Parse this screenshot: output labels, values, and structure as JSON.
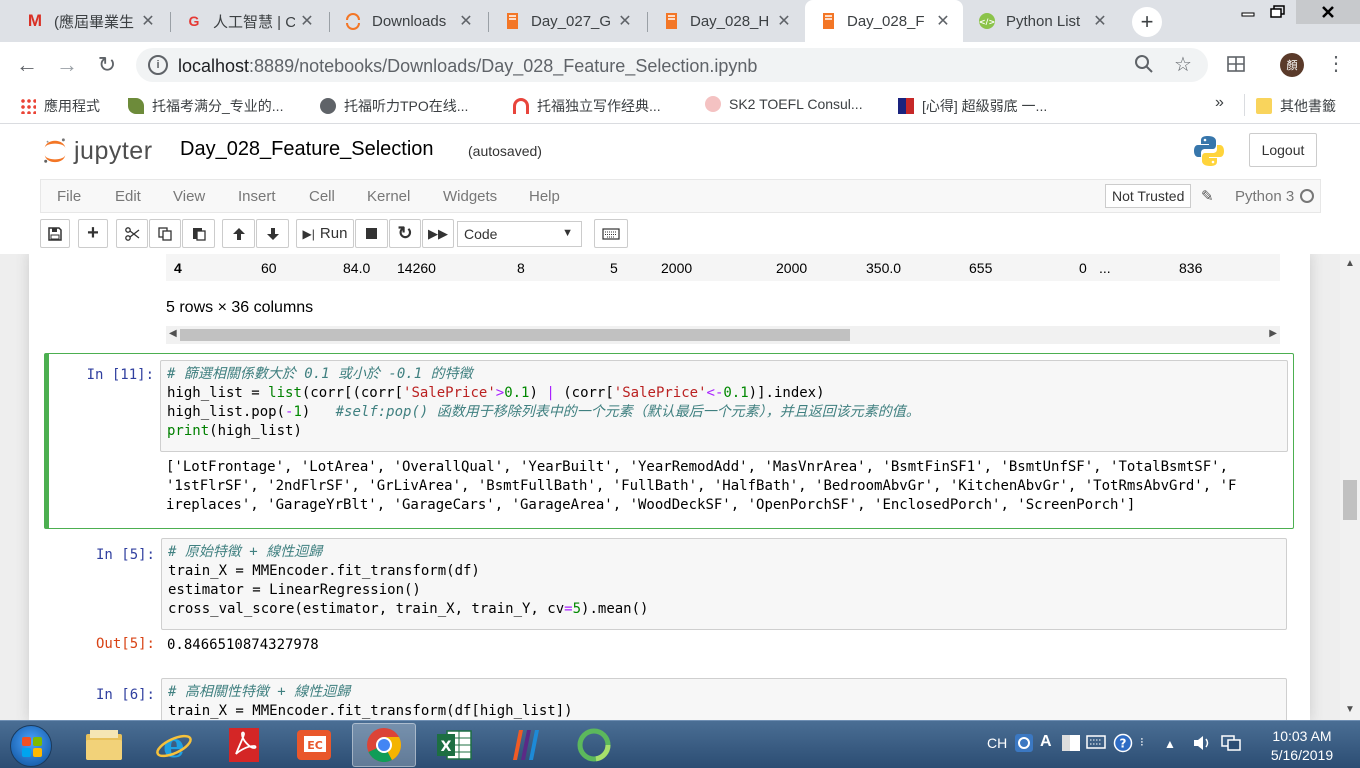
{
  "browser": {
    "tabs": [
      {
        "title": "(應屆畢業生",
        "icon": "gmail-icon",
        "active": false
      },
      {
        "title": "人工智慧 | C",
        "icon": "cupoy-icon",
        "active": false
      },
      {
        "title": "Downloads",
        "icon": "jupyter-tab-icon",
        "active": false
      },
      {
        "title": "Day_027_G",
        "icon": "notebook-tab-icon",
        "active": false
      },
      {
        "title": "Day_028_H",
        "icon": "notebook-tab-icon",
        "active": false
      },
      {
        "title": "Day_028_F",
        "icon": "notebook-tab-icon",
        "active": true
      },
      {
        "title": "Python List",
        "icon": "runoob-icon",
        "active": false
      }
    ],
    "url_host": "localhost",
    "url_rest": ":8889/notebooks/Downloads/Day_028_Feature_Selection.ipynb",
    "avatar_text": "顏",
    "bookmarks": [
      {
        "label": "應用程式"
      },
      {
        "label": "托福考满分_专业的..."
      },
      {
        "label": "托福听力TPO在线..."
      },
      {
        "label": "托福独立写作经典..."
      },
      {
        "label": "SK2 TOEFL Consul..."
      },
      {
        "label": "[心得] 超級弱底 一..."
      },
      {
        "label": "»"
      },
      {
        "label": "其他書籤"
      }
    ]
  },
  "jupyter": {
    "logo_text": "jupyter",
    "notebook_name": "Day_028_Feature_Selection",
    "autosave": "(autosaved)",
    "logout": "Logout",
    "menu": [
      "File",
      "Edit",
      "View",
      "Insert",
      "Cell",
      "Kernel",
      "Widgets",
      "Help"
    ],
    "not_trusted": "Not Trusted",
    "kernel": "Python 3",
    "run_label": "Run",
    "cell_type": "Code"
  },
  "notebook": {
    "table_row": [
      "4",
      "60",
      "84.0",
      "14260",
      "8",
      "5",
      "2000",
      "2000",
      "350.0",
      "655",
      "0",
      "...",
      "836"
    ],
    "rows_info": "5 rows × 36 columns",
    "cells": [
      {
        "prompt": "In [11]:",
        "lines": [
          "# 篩選相關係數大於 0.1 或小於 -0.1 的特徵",
          "high_list = list(corr[(corr['SalePrice']>0.1) | (corr['SalePrice']<-0.1)].index)",
          "high_list.pop(-1)   #self:pop() 函数用于移除列表中的一个元素（默认最后一个元素），并且返回该元素的值。",
          "print(high_list)"
        ],
        "output": [
          "['LotFrontage', 'LotArea', 'OverallQual', 'YearBuilt', 'YearRemodAdd', 'MasVnrArea', 'BsmtFinSF1', 'BsmtUnfSF', 'TotalBsmtSF',",
          "'1stFlrSF', '2ndFlrSF', 'GrLivArea', 'BsmtFullBath', 'FullBath', 'HalfBath', 'BedroomAbvGr', 'KitchenAbvGr', 'TotRmsAbvGrd', 'F",
          "ireplaces', 'GarageYrBlt', 'GarageCars', 'GarageArea', 'WoodDeckSF', 'OpenPorchSF', 'EnclosedPorch', 'ScreenPorch']"
        ]
      },
      {
        "prompt": "In [5]:",
        "lines": [
          "# 原始特徵 + 線性迴歸",
          "train_X = MMEncoder.fit_transform(df)",
          "estimator = LinearRegression()",
          "cross_val_score(estimator, train_X, train_Y, cv=5).mean()"
        ],
        "out_prompt": "Out[5]:",
        "output": [
          "0.8466510874327978"
        ]
      },
      {
        "prompt": "In [6]:",
        "lines": [
          "# 高相關性特徵 + 線性迴歸",
          "train_X = MMEncoder.fit_transform(df[high_list])"
        ]
      }
    ]
  },
  "taskbar": {
    "apps": [
      "explorer-icon",
      "ie-icon",
      "acrobat-icon",
      "easycard-icon",
      "chrome-icon",
      "excel-icon",
      "winrar-icon",
      "green-app-icon"
    ],
    "lang": "CH",
    "time": "10:03 AM",
    "date": "5/16/2019"
  }
}
